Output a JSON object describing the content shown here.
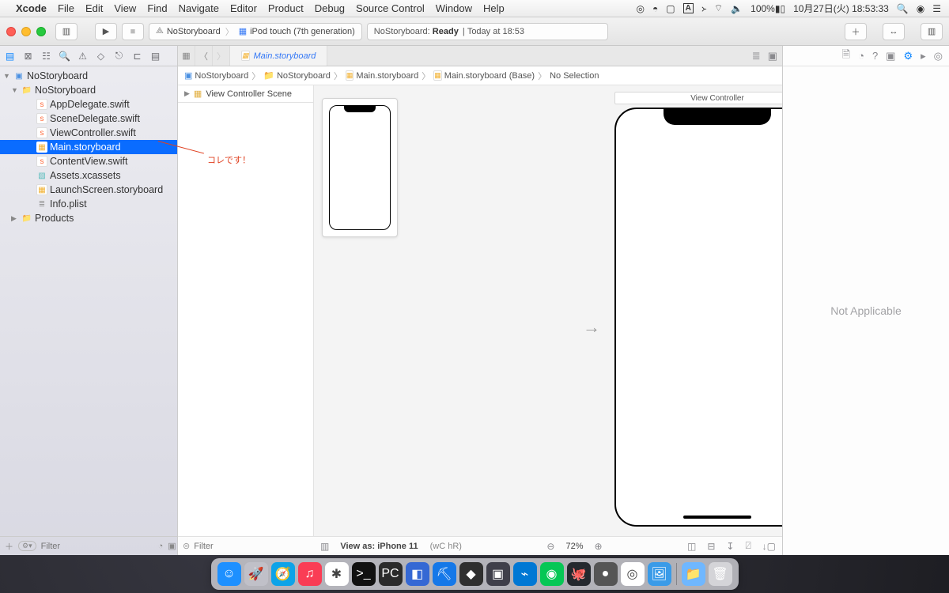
{
  "menubar": {
    "app": "Xcode",
    "items": [
      "File",
      "Edit",
      "View",
      "Find",
      "Navigate",
      "Editor",
      "Product",
      "Debug",
      "Source Control",
      "Window",
      "Help"
    ],
    "battery": "100%",
    "clock": "10月27日(火)  18:53:33"
  },
  "toolbar": {
    "scheme_project": "NoStoryboard",
    "scheme_device": "iPod touch (7th generation)",
    "activity_project": "NoStoryboard:",
    "activity_status": "Ready",
    "activity_time": "Today at 18:53"
  },
  "navigator": {
    "root": "NoStoryboard",
    "group": "NoStoryboard",
    "files": [
      {
        "name": "AppDelegate.swift",
        "type": "swift"
      },
      {
        "name": "SceneDelegate.swift",
        "type": "swift"
      },
      {
        "name": "ViewController.swift",
        "type": "swift"
      },
      {
        "name": "Main.storyboard",
        "type": "sb",
        "selected": true
      },
      {
        "name": "ContentView.swift",
        "type": "swift"
      },
      {
        "name": "Assets.xcassets",
        "type": "asset"
      },
      {
        "name": "LaunchScreen.storyboard",
        "type": "sb"
      },
      {
        "name": "Info.plist",
        "type": "plist"
      }
    ],
    "products": "Products",
    "filter_placeholder": "Filter"
  },
  "annotation": "コレです！",
  "tab": {
    "name": "Main.storyboard"
  },
  "jumpbar": {
    "segments": [
      "NoStoryboard",
      "NoStoryboard",
      "Main.storyboard",
      "Main.storyboard (Base)",
      "No Selection"
    ]
  },
  "outline": {
    "scene": "View Controller Scene",
    "filter_placeholder": "Filter"
  },
  "canvas": {
    "vc_label": "View Controller",
    "viewas": "View as: iPhone 11",
    "traits": "(wC hR)",
    "zoom": "72%"
  },
  "inspector": {
    "empty": "Not Applicable"
  },
  "dock": {
    "apps": [
      {
        "n": "finder",
        "bg": "#1e90ff",
        "g": "☺"
      },
      {
        "n": "launchpad",
        "bg": "#c0c0c8",
        "g": "🚀"
      },
      {
        "n": "safari",
        "bg": "#0da3e8",
        "g": "🧭"
      },
      {
        "n": "music",
        "bg": "#fa3d55",
        "g": "♫"
      },
      {
        "n": "slack",
        "bg": "#fff",
        "g": "✱"
      },
      {
        "n": "terminal",
        "bg": "#111",
        "g": ">_"
      },
      {
        "n": "pycharm",
        "bg": "#2b2b2b",
        "g": "PC"
      },
      {
        "n": "foo1",
        "bg": "#3568d4",
        "g": "◧"
      },
      {
        "n": "xcode",
        "bg": "#1578e8",
        "g": "⛏"
      },
      {
        "n": "foo2",
        "bg": "#2f2f2f",
        "g": "◆"
      },
      {
        "n": "foo3",
        "bg": "#3f3f4a",
        "g": "▣"
      },
      {
        "n": "vscode",
        "bg": "#0078d4",
        "g": "⌁"
      },
      {
        "n": "line",
        "bg": "#06c755",
        "g": "◉"
      },
      {
        "n": "github",
        "bg": "#24292e",
        "g": "🐙"
      },
      {
        "n": "foo4",
        "bg": "#555",
        "g": "●"
      },
      {
        "n": "chrome",
        "bg": "#fff",
        "g": "◎"
      },
      {
        "n": "preview",
        "bg": "#3a9be8",
        "g": "🖼"
      }
    ],
    "right": [
      {
        "n": "folder",
        "bg": "#6fb7ff",
        "g": "📁"
      },
      {
        "n": "trash",
        "bg": "#d4d4d8",
        "g": "🗑"
      }
    ]
  }
}
